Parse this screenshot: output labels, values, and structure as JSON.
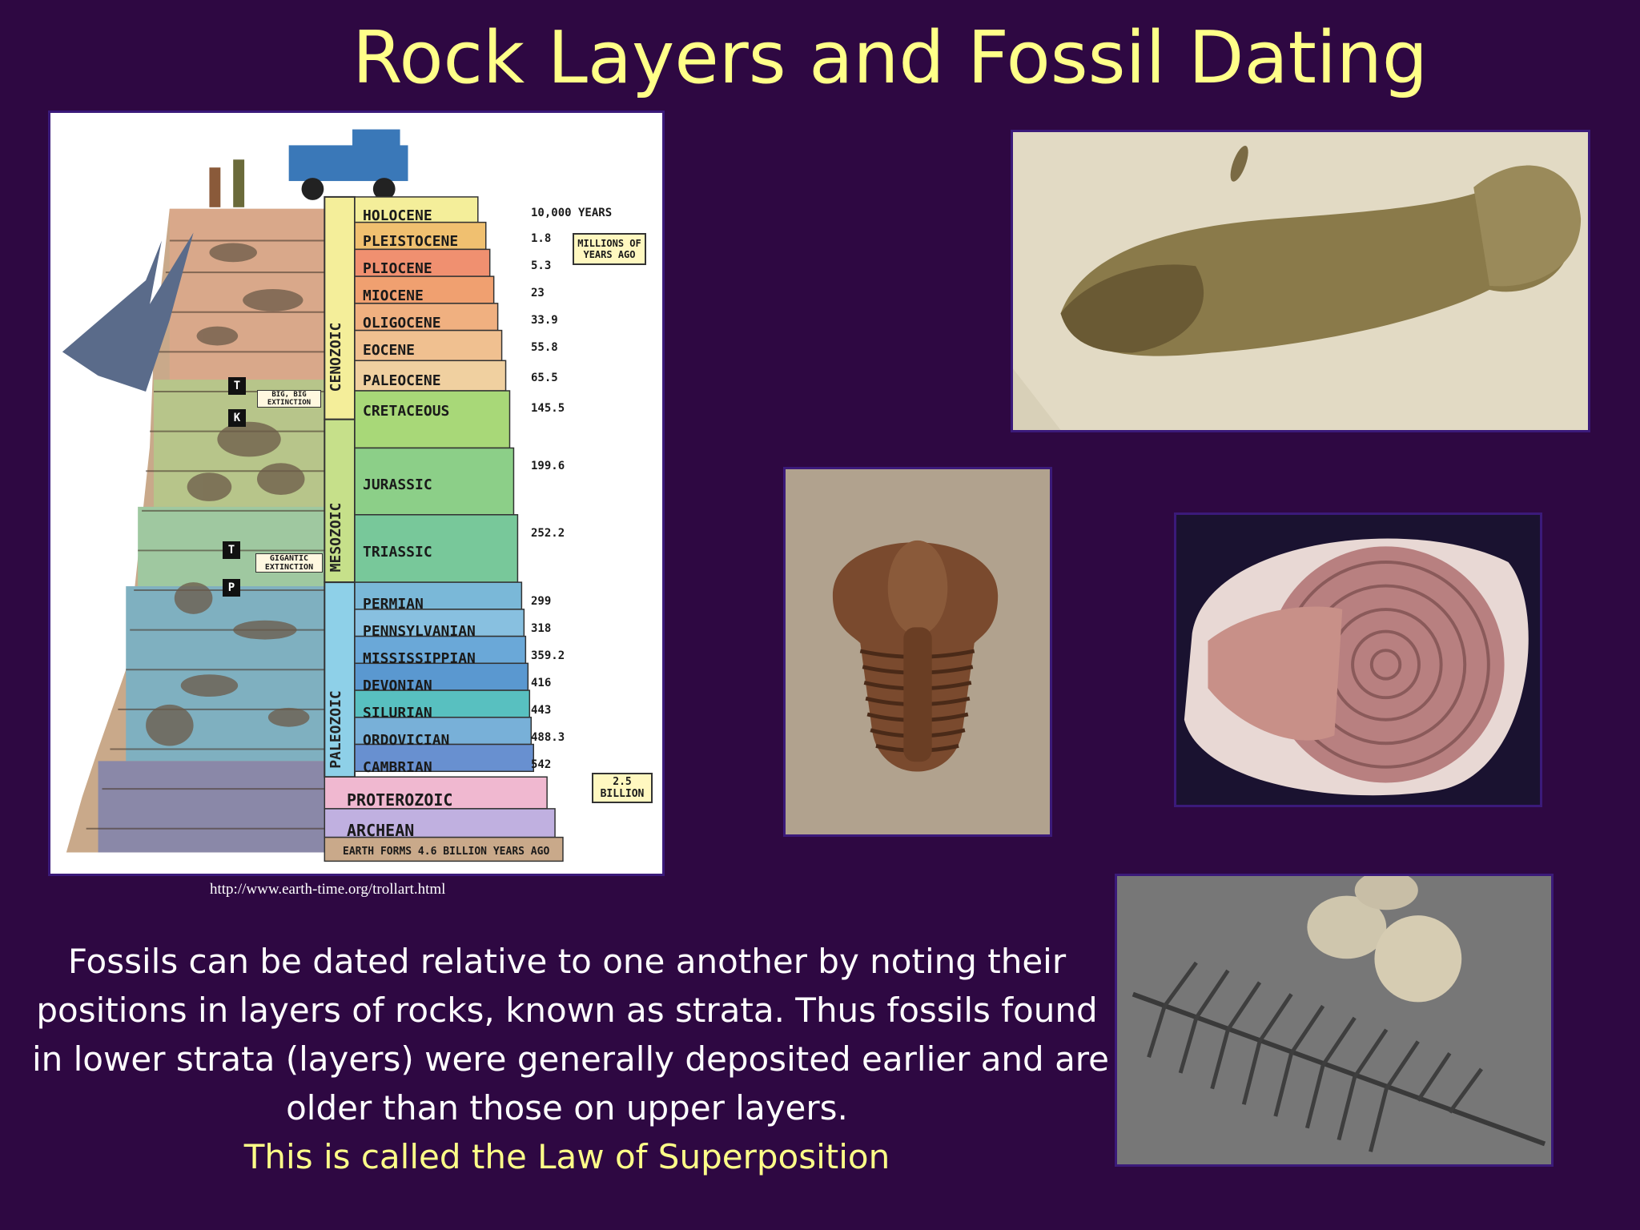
{
  "slide": {
    "title": "Rock Layers and Fossil Dating",
    "credit": "http://www.earth-time.org/trollart.html",
    "body_lines": [
      "Fossils can be dated relative to one another by noting their",
      "positions in layers of rocks, known as strata.  Thus fossils found",
      "in lower strata (layers) were generally deposited earlier and are",
      "older than those on upper layers."
    ],
    "law_line": "This is called the Law of Superposition",
    "title_color": "#ffff88",
    "background_color": "#2e0842"
  },
  "strata_chart": {
    "eras": [
      "CENOZOIC",
      "MESOZOIC",
      "PALEOZOIC"
    ],
    "periods": [
      {
        "name": "HOLOCENE",
        "age": "10,000 YEARS"
      },
      {
        "name": "PLEISTOCENE",
        "age": "1.8"
      },
      {
        "name": "PLIOCENE",
        "age": "5.3"
      },
      {
        "name": "MIOCENE",
        "age": "23"
      },
      {
        "name": "OLIGOCENE",
        "age": "33.9"
      },
      {
        "name": "EOCENE",
        "age": "55.8"
      },
      {
        "name": "PALEOCENE",
        "age": "65.5"
      },
      {
        "name": "CRETACEOUS",
        "age": "145.5"
      },
      {
        "name": "JURASSIC",
        "age": "199.6"
      },
      {
        "name": "TRIASSIC",
        "age": "252.2"
      },
      {
        "name": "PERMIAN",
        "age": "299"
      },
      {
        "name": "PENNSYLVANIAN",
        "age": "318"
      },
      {
        "name": "MISSISSIPPIAN",
        "age": "359.2"
      },
      {
        "name": "DEVONIAN",
        "age": "416"
      },
      {
        "name": "SILURIAN",
        "age": "443"
      },
      {
        "name": "ORDOVICIAN",
        "age": "488.3"
      },
      {
        "name": "CAMBRIAN",
        "age": "542"
      },
      {
        "name": "PROTEROZOIC",
        "age": "2.5 BILLION"
      },
      {
        "name": "ARCHEAN",
        "age": ""
      }
    ],
    "units_box": "MILLIONS OF YEARS AGO",
    "bottom_label": "EARTH FORMS 4.6 BILLION YEARS AGO",
    "boundary_tags": [
      "T",
      "K",
      "T",
      "P"
    ],
    "extinction_notes": [
      "BIG, BIG EXTINCTION",
      "GIGANTIC EXTINCTION"
    ]
  }
}
